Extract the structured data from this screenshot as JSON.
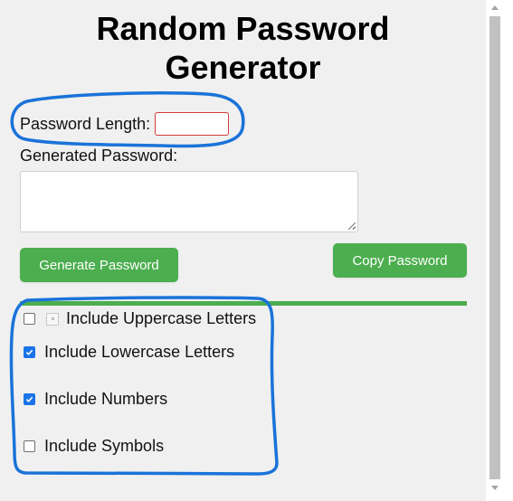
{
  "title": {
    "line1": "Random Password",
    "line2": "Generator"
  },
  "length": {
    "label": "Password Length:",
    "value": ""
  },
  "generated": {
    "label": "Generated Password:",
    "value": ""
  },
  "buttons": {
    "generate": "Generate Password",
    "copy": "Copy Password"
  },
  "options": [
    {
      "label": "Include Uppercase Letters",
      "checked": false
    },
    {
      "label": "Include Lowercase Letters",
      "checked": true
    },
    {
      "label": "Include Numbers",
      "checked": true
    },
    {
      "label": "Include Symbols",
      "checked": false
    }
  ],
  "colors": {
    "accent": "#4cae4f",
    "annotation": "#1a73d9",
    "checkbox": "#1a73e8"
  }
}
